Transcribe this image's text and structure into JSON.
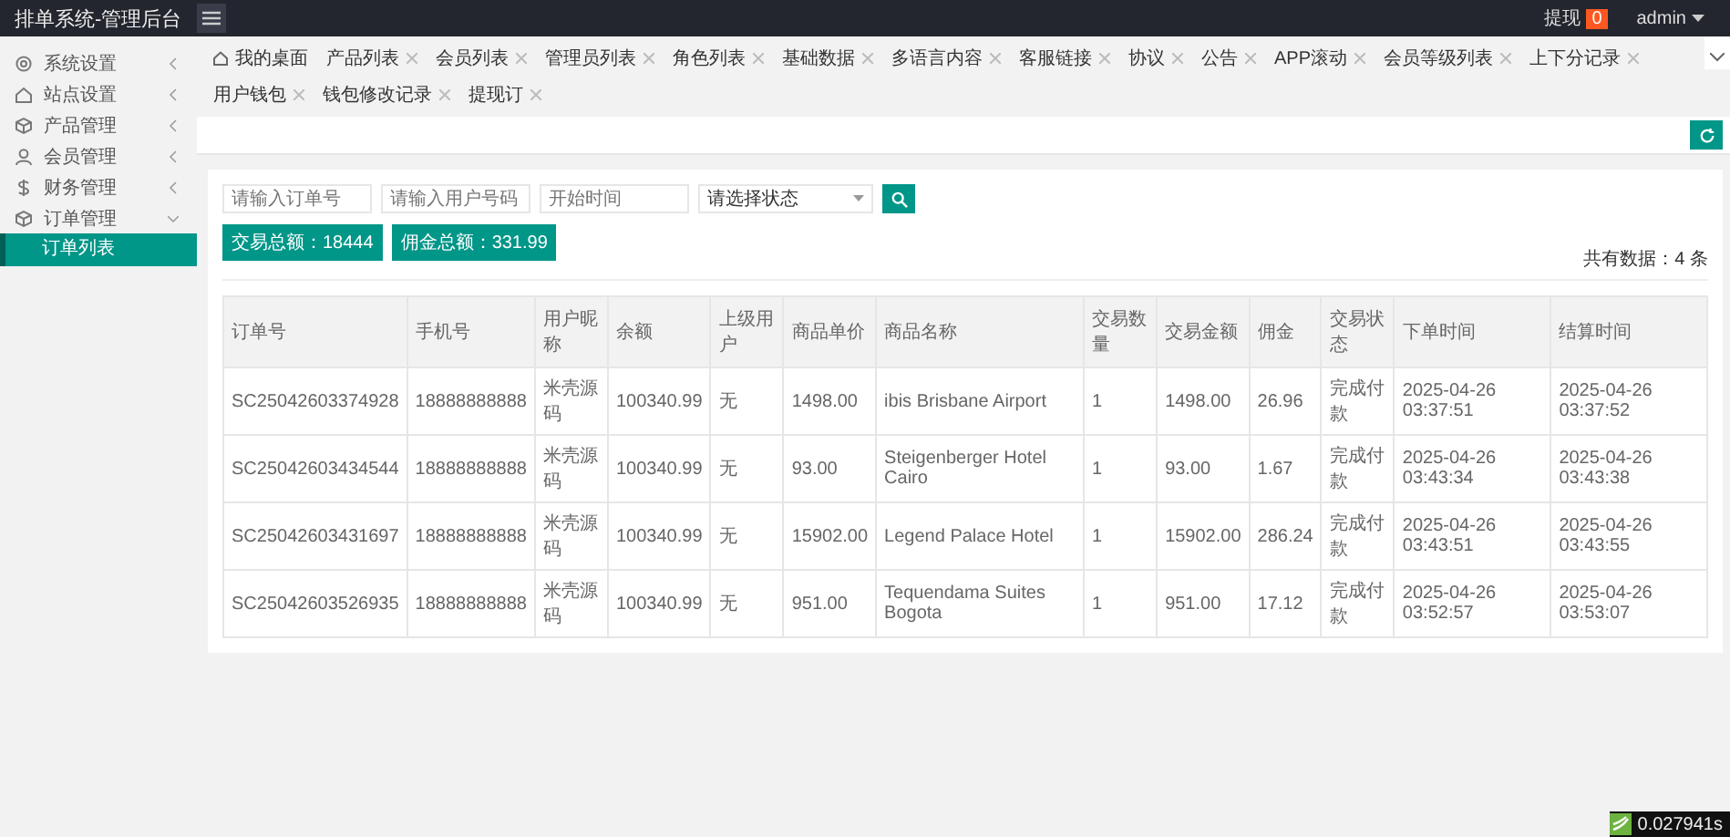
{
  "header": {
    "title": "排单系统-管理后台",
    "withdraw_label": "提现",
    "withdraw_count": "0",
    "user": "admin"
  },
  "sidebar": {
    "items": [
      {
        "label": "系统设置",
        "kind": "gear",
        "expanded": false
      },
      {
        "label": "站点设置",
        "kind": "site",
        "expanded": false
      },
      {
        "label": "产品管理",
        "kind": "box",
        "expanded": false
      },
      {
        "label": "会员管理",
        "kind": "user",
        "expanded": false
      },
      {
        "label": "财务管理",
        "kind": "dollar",
        "expanded": false
      },
      {
        "label": "订单管理",
        "kind": "box",
        "expanded": true,
        "children": [
          {
            "label": "订单列表",
            "selected": true
          }
        ]
      }
    ]
  },
  "tabs": [
    {
      "label": "我的桌面",
      "kind": "home",
      "selected": false
    },
    {
      "label": "产品列表",
      "kind": "closable",
      "selected": false
    },
    {
      "label": "会员列表",
      "kind": "closable",
      "selected": false
    },
    {
      "label": "管理员列表",
      "kind": "closable",
      "selected": false
    },
    {
      "label": "角色列表",
      "kind": "closable",
      "selected": false
    },
    {
      "label": "基础数据",
      "kind": "closable",
      "selected": false
    },
    {
      "label": "多语言内容",
      "kind": "closable",
      "selected": false
    },
    {
      "label": "客服链接",
      "kind": "closable",
      "selected": false
    },
    {
      "label": "协议",
      "kind": "closable",
      "selected": false
    },
    {
      "label": "公告",
      "kind": "closable",
      "selected": false
    },
    {
      "label": "APP滚动",
      "kind": "closable",
      "selected": false
    },
    {
      "label": "会员等级列表",
      "kind": "closable",
      "selected": false
    },
    {
      "label": "上下分记录",
      "kind": "closable",
      "selected": false
    },
    {
      "label": "用户钱包",
      "kind": "closable",
      "selected": false
    },
    {
      "label": "钱包修改记录",
      "kind": "closable",
      "selected": false
    },
    {
      "label": "提现订",
      "kind": "closable",
      "selected": false
    }
  ],
  "filters": {
    "order_no": {
      "placeholder": "请输入订单号"
    },
    "phone": {
      "placeholder": "请输入用户号码"
    },
    "start_time": {
      "placeholder": "开始时间"
    },
    "status": {
      "value": "请选择状态"
    }
  },
  "summary": {
    "trade_total": "交易总额：18444",
    "commission_total": "佣金总额：331.99",
    "count": "共有数据：4 条"
  },
  "table": {
    "columns": [
      "订单号",
      "手机号",
      "用户昵称",
      "余额",
      "上级用户",
      "商品单价",
      "商品名称",
      "交易数量",
      "交易金额",
      "佣金",
      "交易状态",
      "下单时间",
      "结算时间"
    ],
    "rows": [
      [
        "SC25042603374928",
        "18888888888",
        "米壳源码",
        "100340.99",
        "无",
        "1498.00",
        "ibis Brisbane Airport",
        "1",
        "1498.00",
        "26.96",
        "完成付款",
        "2025-04-26 03:37:51",
        "2025-04-26 03:37:52"
      ],
      [
        "SC25042603434544",
        "18888888888",
        "米壳源码",
        "100340.99",
        "无",
        "93.00",
        "Steigenberger Hotel Cairo",
        "1",
        "93.00",
        "1.67",
        "完成付款",
        "2025-04-26 03:43:34",
        "2025-04-26 03:43:38"
      ],
      [
        "SC25042603431697",
        "18888888888",
        "米壳源码",
        "100340.99",
        "无",
        "15902.00",
        "Legend Palace Hotel",
        "1",
        "15902.00",
        "286.24",
        "完成付款",
        "2025-04-26 03:43:51",
        "2025-04-26 03:43:55"
      ],
      [
        "SC25042603526935",
        "18888888888",
        "米壳源码",
        "100340.99",
        "无",
        "951.00",
        "Tequendama Suites Bogota",
        "1",
        "951.00",
        "17.12",
        "完成付款",
        "2025-04-26 03:52:57",
        "2025-04-26 03:53:07"
      ]
    ]
  },
  "debug": {
    "time": "0.027941s"
  }
}
